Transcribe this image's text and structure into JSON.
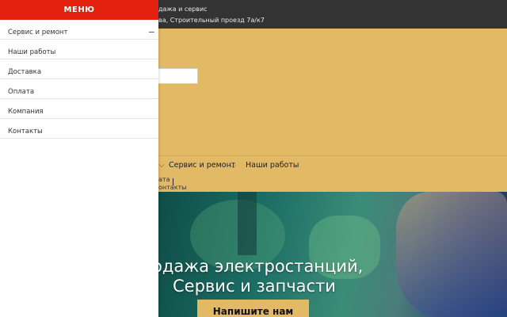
{
  "topbar": {
    "line1": "дажа и сервис",
    "line2": "ва, Строительный проезд 7а/к7"
  },
  "nav": {
    "item1": "Сервис и ремонт",
    "item2": "Наши работы",
    "sub1": "ата",
    "sub2": "онтакты"
  },
  "hero": {
    "title1": "одажа электростанций,",
    "title2": "Сервис и запчасти",
    "cta": "Напишите нам"
  },
  "menu": {
    "title": "МЕНЮ",
    "collapse_icon": "−",
    "items": [
      "Сервис и ремонт",
      "Наши работы",
      "Доставка",
      "Оплата",
      "Компания",
      "Контакты"
    ]
  }
}
